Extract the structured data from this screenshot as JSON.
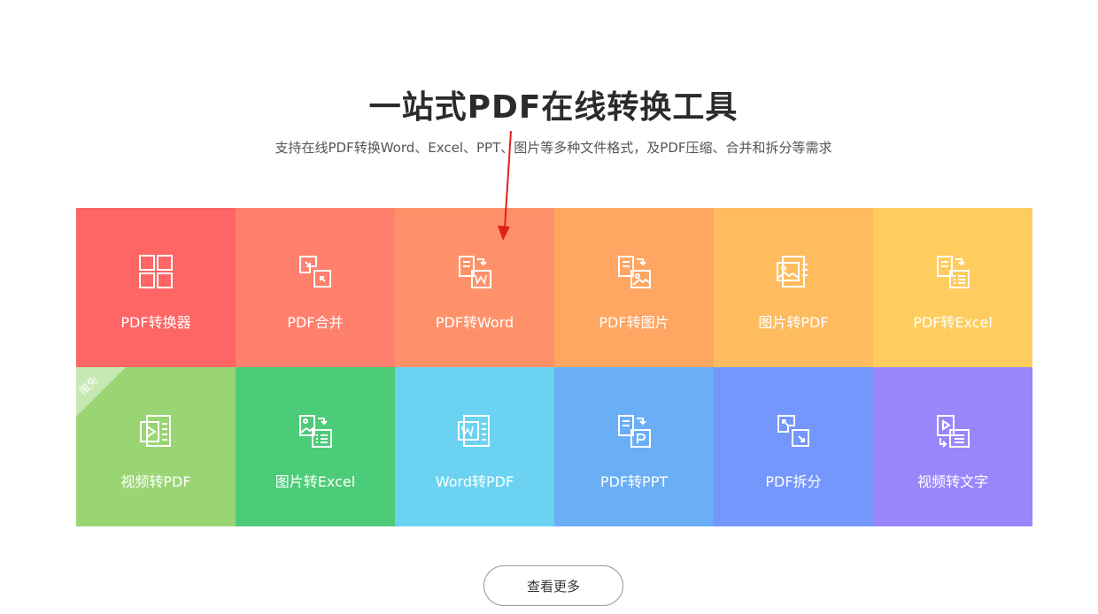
{
  "header": {
    "title": "一站式PDF在线转换工具",
    "subtitle": "支持在线PDF转换Word、Excel、PPT、图片等多种文件格式，及PDF压缩、合并和拆分等需求"
  },
  "tiles": [
    {
      "label": "PDF转换器",
      "icon": "grid-icon",
      "color": "#fe6565"
    },
    {
      "label": "PDF合并",
      "icon": "merge-icon",
      "color": "#ff806c"
    },
    {
      "label": "PDF转Word",
      "icon": "pdf-to-word-icon",
      "color": "#ff916a"
    },
    {
      "label": "PDF转图片",
      "icon": "pdf-to-image-icon",
      "color": "#ffa662"
    },
    {
      "label": "图片转PDF",
      "icon": "image-to-pdf-icon",
      "color": "#ffbc5f"
    },
    {
      "label": "PDF转Excel",
      "icon": "pdf-to-excel-icon",
      "color": "#ffcd5f"
    },
    {
      "label": "视频转PDF",
      "icon": "video-to-pdf-icon",
      "color": "#9ad574",
      "badge": "限免"
    },
    {
      "label": "图片转Excel",
      "icon": "image-to-excel-icon",
      "color": "#4ccc78"
    },
    {
      "label": "Word转PDF",
      "icon": "word-to-pdf-icon",
      "color": "#6bd3f1"
    },
    {
      "label": "PDF转PPT",
      "icon": "pdf-to-ppt-icon",
      "color": "#6aaff6"
    },
    {
      "label": "PDF拆分",
      "icon": "split-icon",
      "color": "#7397fd"
    },
    {
      "label": "视频转文字",
      "icon": "video-to-text-icon",
      "color": "#9a86fb"
    }
  ],
  "more_button": {
    "label": "查看更多"
  },
  "annotation": {
    "arrow_color": "#e0211f"
  }
}
